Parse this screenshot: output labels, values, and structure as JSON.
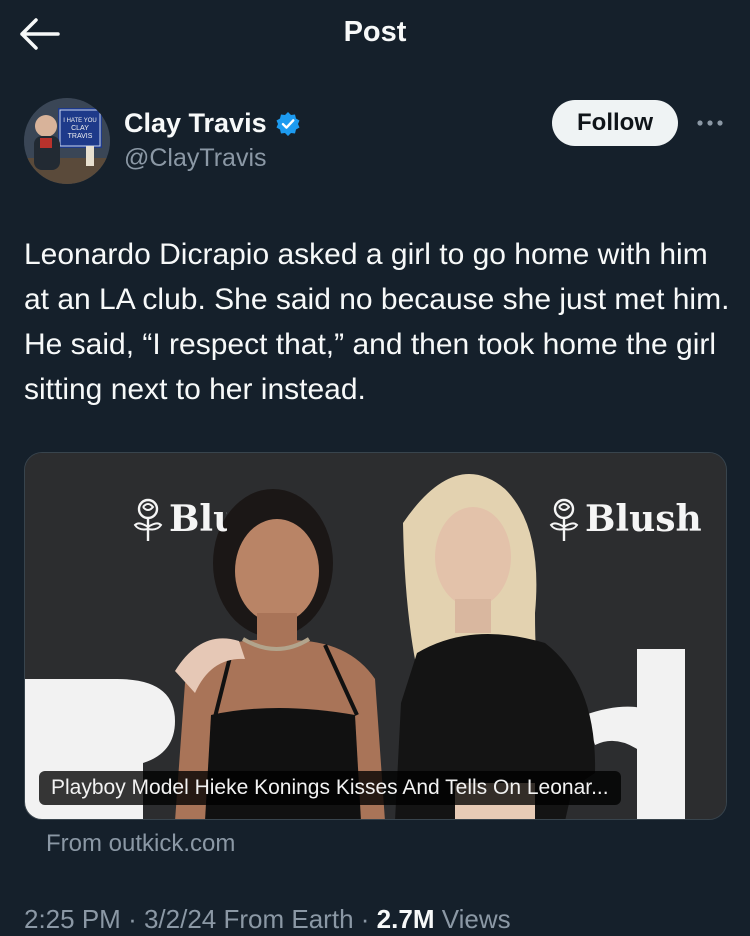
{
  "header": {
    "title": "Post",
    "back_icon": "arrow-left-icon"
  },
  "author": {
    "name": "Clay Travis",
    "handle": "@ClayTravis",
    "verified_icon": "verified-badge-icon",
    "verified_color": "#1d9bf0",
    "avatar_sign_text": "I HATE YOU CLAY TRAVIS"
  },
  "actions": {
    "follow_label": "Follow",
    "more_icon": "more-options-icon"
  },
  "tweet": {
    "text": "Leonardo Dicrapio asked a girl to go home with him at an LA club. She said no because she just met him. He said, “I respect that,” and then took home the girl sitting next to her instead."
  },
  "card": {
    "brand_left": "Blush",
    "brand_right": "Blush",
    "rose_icon": "rose-logo-icon",
    "caption": "Playboy Model Hieke Konings Kisses And Tells On Leonar...",
    "source": "From outkick.com"
  },
  "meta": {
    "time": "2:25 PM",
    "separator": "·",
    "date": "3/2/24",
    "location": "From Earth",
    "views_count": "2.7M",
    "views_label": "Views"
  },
  "colors": {
    "background": "#15202b",
    "text_primary": "#f7f9f9",
    "text_secondary": "#8b98a5",
    "accent": "#1d9bf0",
    "follow_bg": "#eff3f4"
  }
}
